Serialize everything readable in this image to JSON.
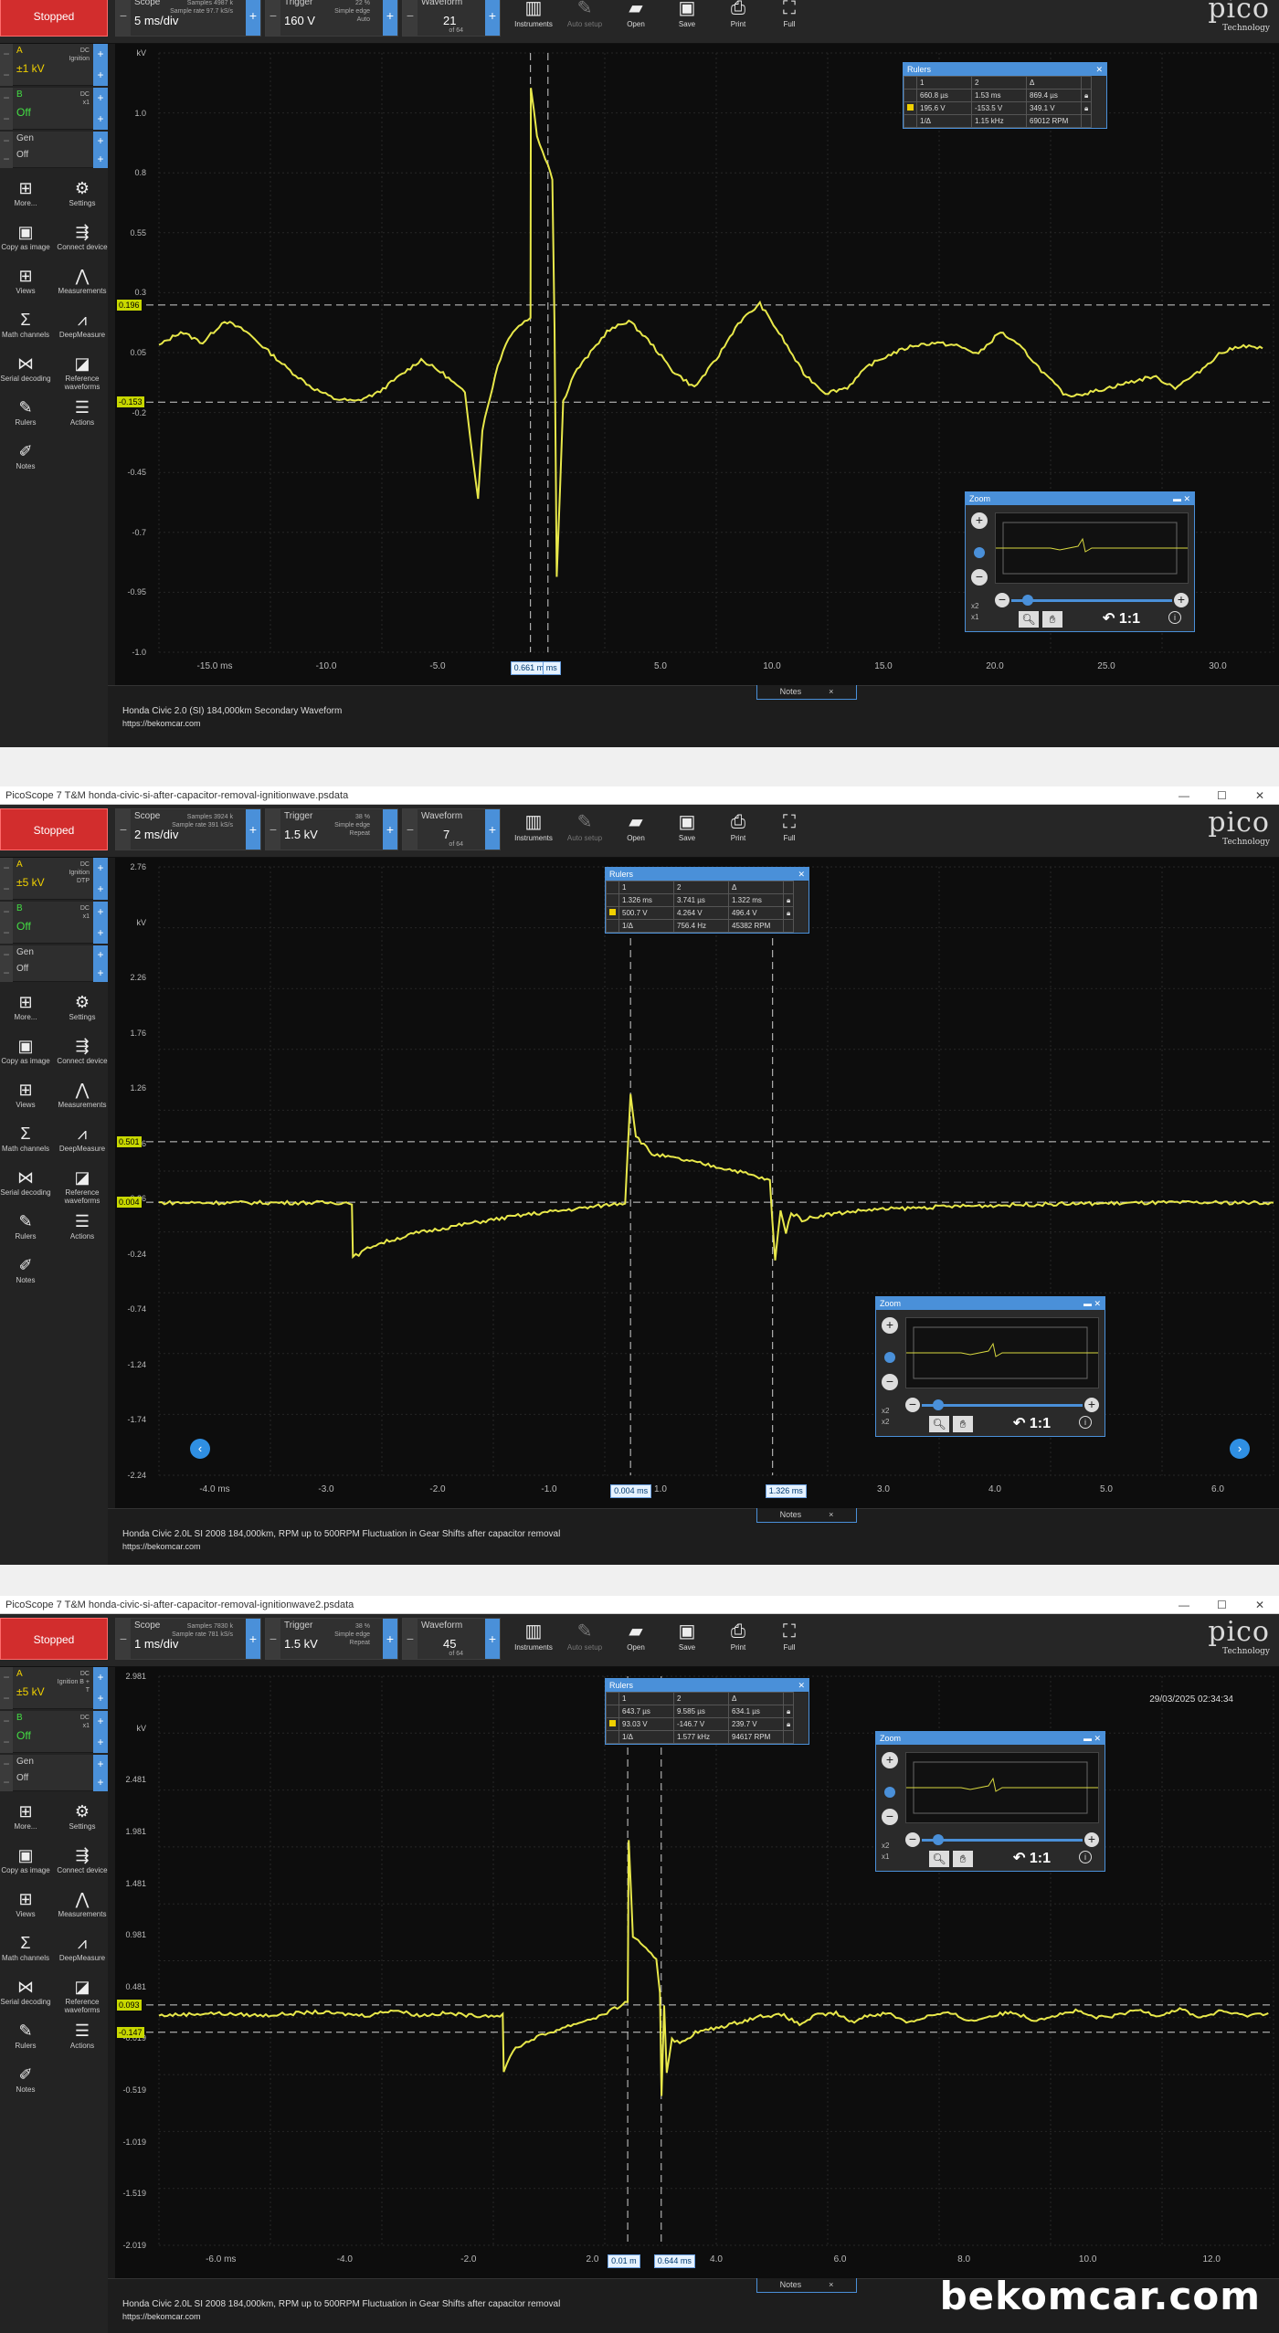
{
  "colors": {
    "trace": "#e8e84a",
    "accent": "#4a90d9",
    "stopped": "#d22d2d",
    "grid": "#2a2a2a",
    "ruler_label": "#c8d800"
  },
  "toolbar_common": {
    "stopped": "Stopped",
    "scope_label": "Scope",
    "trigger_label": "Trigger",
    "waveform_label": "Waveform",
    "instruments": "Instruments",
    "auto_setup": "Auto setup",
    "open": "Open",
    "save": "Save",
    "print": "Print",
    "full": "Full",
    "logo": "pico",
    "logo_sub": "Technology"
  },
  "sidebar_common": {
    "more": "More...",
    "settings": "Settings",
    "copy_image": "Copy as image",
    "connect": "Connect device",
    "views": "Views",
    "measurements": "Measurements",
    "math": "Math channels",
    "deepmeasure": "DeepMeasure",
    "serial": "Serial decoding",
    "reference": "Reference waveforms",
    "rulers": "Rulers",
    "actions": "Actions",
    "notes": "Notes",
    "gen": "Gen",
    "off": "Off",
    "notes_tab": "Notes",
    "notes_close": "×"
  },
  "panels": [
    {
      "window_title": "",
      "toolbar": {
        "scope": "5 ms/div",
        "samples": "Samples 4987 k",
        "sample_rate": "Sample rate 97.7 kS/s",
        "trigger": "160 V",
        "trig_mode": "Simple edge",
        "trig_sub": "Auto",
        "trig_pct": "22 %",
        "waveform": "21",
        "waveform_of": "of 64"
      },
      "channel_a": {
        "name": "A",
        "range": "±1 kV",
        "coupling": "DC",
        "probe": "Ignition"
      },
      "channel_b": {
        "name": "B",
        "state": "Off",
        "coupling": "DC",
        "probe": "x1"
      },
      "y_ticks": [
        "kV",
        "1.0",
        "0.8",
        "0.55",
        "0.3",
        "0.05",
        "-0.2",
        "-0.45",
        "-0.7",
        "-0.95",
        "-1.0"
      ],
      "x_ticks": [
        "-15.0 ms",
        "-10.0",
        "-5.0",
        "0.0",
        "5.0",
        "10.0",
        "15.0",
        "20.0",
        "25.0",
        "30.0"
      ],
      "ruler_labels": [
        "0.196",
        "-0.153"
      ],
      "x_marker": "0.661 ms",
      "x_marker_unit": "ms",
      "rulers": {
        "title": "Rulers",
        "head": [
          "1",
          "2",
          "Δ"
        ],
        "row1": [
          "660.8 µs",
          "1.53 ms",
          "869.4 µs"
        ],
        "row2": [
          "195.6 V",
          "-153.5 V",
          "349.1 V"
        ],
        "row3": [
          "1/Δ",
          "1.15 kHz",
          "69012 RPM"
        ]
      },
      "zoom_title": "Zoom",
      "zoom_1to1": "1:1",
      "zoom_x2": "x2",
      "zoom_x1": "x1",
      "footer_line1": "Honda Civic 2.0 (SI) 184,000km Secondary  Waveform",
      "footer_line2": "https://bekomcar.com",
      "trace": [
        [
          -17,
          0.05
        ],
        [
          -16,
          0.1
        ],
        [
          -15,
          0.06
        ],
        [
          -14,
          0.14
        ],
        [
          -13,
          0.1
        ],
        [
          -12,
          0.03
        ],
        [
          -11,
          -0.04
        ],
        [
          -10,
          -0.1
        ],
        [
          -9,
          -0.14
        ],
        [
          -8,
          -0.15
        ],
        [
          -7,
          -0.12
        ],
        [
          -6,
          -0.06
        ],
        [
          -5,
          0.0
        ],
        [
          -4,
          -0.05
        ],
        [
          -3,
          -0.12
        ],
        [
          -2.4,
          -0.5
        ],
        [
          -2.2,
          -0.25
        ],
        [
          -1.5,
          -0.02
        ],
        [
          -1.0,
          0.08
        ],
        [
          -0.8,
          0.1
        ],
        [
          -0.4,
          0.13
        ],
        [
          0.0,
          0.15
        ],
        [
          0.02,
          0.98
        ],
        [
          0.3,
          0.8
        ],
        [
          0.8,
          0.7
        ],
        [
          1.0,
          0.65
        ],
        [
          1.1,
          0.12
        ],
        [
          1.2,
          -0.78
        ],
        [
          1.5,
          -0.15
        ],
        [
          2.0,
          -0.05
        ],
        [
          2.5,
          0.0
        ],
        [
          3.5,
          0.1
        ],
        [
          4.5,
          0.14
        ],
        [
          5.5,
          0.06
        ],
        [
          6.5,
          -0.04
        ],
        [
          7.5,
          -0.1
        ],
        [
          8.5,
          0.0
        ],
        [
          9.5,
          0.13
        ],
        [
          10.5,
          0.2
        ],
        [
          11.5,
          0.08
        ],
        [
          12.5,
          -0.05
        ],
        [
          13.5,
          -0.12
        ],
        [
          14.5,
          -0.1
        ],
        [
          15.5,
          -0.02
        ],
        [
          16.5,
          0.02
        ],
        [
          17.5,
          0.05
        ],
        [
          18.5,
          0.06
        ],
        [
          19.5,
          0.05
        ],
        [
          20.5,
          0.02
        ],
        [
          21.5,
          0.1
        ],
        [
          22.5,
          0.04
        ],
        [
          23.5,
          -0.05
        ],
        [
          24.5,
          -0.13
        ],
        [
          25.5,
          -0.12
        ],
        [
          26.5,
          -0.1
        ],
        [
          27.5,
          -0.08
        ],
        [
          28.5,
          -0.06
        ],
        [
          29.5,
          -0.1
        ],
        [
          30.5,
          -0.05
        ],
        [
          31.5,
          0.02
        ],
        [
          32.5,
          0.05
        ],
        [
          33.5,
          0.04
        ]
      ],
      "x_range": [
        -17,
        34
      ],
      "y_range": [
        -1.05,
        1.1
      ],
      "rulers_v": [
        0.196,
        -0.153
      ],
      "rulers_t": [
        0.0,
        0.8
      ]
    },
    {
      "window_title": "PicoScope 7 T&M honda-civic-si-after-capacitor-removal-ignitionwave.psdata",
      "toolbar": {
        "scope": "2 ms/div",
        "samples": "Samples 3924 k",
        "sample_rate": "Sample rate 391 kS/s",
        "trigger": "1.5 kV",
        "trig_mode": "Simple edge",
        "trig_sub": "Repeat",
        "trig_pct": "38 %",
        "waveform": "7",
        "waveform_of": "of 64"
      },
      "channel_a": {
        "name": "A",
        "range": "±5 kV",
        "coupling": "DC",
        "probe": "Ignition DTP"
      },
      "channel_b": {
        "name": "B",
        "state": "Off",
        "coupling": "DC",
        "probe": "x1"
      },
      "y_ticks": [
        "2.76",
        "kV",
        "2.26",
        "1.76",
        "1.26",
        "0.76",
        "0.26",
        "-0.24",
        "-0.74",
        "-1.24",
        "-1.74",
        "-2.24"
      ],
      "x_ticks": [
        "-4.0 ms",
        "-3.0",
        "-2.0",
        "-1.0",
        "1.0",
        "2.0",
        "3.0",
        "4.0",
        "5.0",
        "6.0"
      ],
      "ruler_labels": [
        "0.501",
        "0.004"
      ],
      "x_marker": "0.004 ms",
      "x_marker2": "1.326 ms",
      "rulers": {
        "title": "Rulers",
        "head": [
          "1",
          "2",
          "Δ"
        ],
        "row1": [
          "1.326 ms",
          "3.741 µs",
          "1.322 ms"
        ],
        "row2": [
          "500.7 V",
          "4.264 V",
          "496.4 V"
        ],
        "row3": [
          "1/Δ",
          "756.4 Hz",
          "45382 RPM"
        ]
      },
      "zoom_title": "Zoom",
      "zoom_1to1": "1:1",
      "zoom_x2": "x2",
      "zoom_x1": "x2",
      "footer_line1": "Honda Civic 2.0L SI 2008 184,000km, RPM up to 500RPM Fluctuation in  Gear Shifts after capacitor removal",
      "footer_line2": "https://bekomcar.com",
      "trace": [
        [
          -4.4,
          0.0
        ],
        [
          -3.0,
          0.0
        ],
        [
          -2.6,
          0.0
        ],
        [
          -2.59,
          -0.45
        ],
        [
          -2.4,
          -0.35
        ],
        [
          -2.0,
          -0.25
        ],
        [
          -1.5,
          -0.17
        ],
        [
          -1.0,
          -0.1
        ],
        [
          -0.5,
          -0.05
        ],
        [
          -0.05,
          0.0
        ],
        [
          0.0,
          0.9
        ],
        [
          0.05,
          0.55
        ],
        [
          0.2,
          0.4
        ],
        [
          0.5,
          0.35
        ],
        [
          1.0,
          0.26
        ],
        [
          1.3,
          0.18
        ],
        [
          1.32,
          -0.1
        ],
        [
          1.35,
          -0.48
        ],
        [
          1.4,
          -0.05
        ],
        [
          1.45,
          -0.25
        ],
        [
          1.5,
          -0.08
        ],
        [
          1.6,
          -0.14
        ],
        [
          1.8,
          -0.1
        ],
        [
          2.2,
          -0.06
        ],
        [
          3.0,
          -0.03
        ],
        [
          4.0,
          -0.01
        ],
        [
          5.0,
          0.0
        ],
        [
          6.0,
          0.0
        ]
      ],
      "x_range": [
        -4.4,
        6.0
      ],
      "y_range": [
        -2.24,
        2.76
      ],
      "rulers_v": [
        0.501,
        0.004
      ],
      "rulers_t": [
        0.0,
        1.326
      ]
    },
    {
      "window_title": "PicoScope 7 T&M honda-civic-si-after-capacitor-removal-ignitionwave2.psdata",
      "toolbar": {
        "scope": "1 ms/div",
        "samples": "Samples 7830 k",
        "sample_rate": "Sample rate 781 kS/s",
        "trigger": "1.5 kV",
        "trig_mode": "Simple edge",
        "trig_sub": "Repeat",
        "trig_pct": "38 %",
        "waveform": "45",
        "waveform_of": "of 64"
      },
      "channel_a": {
        "name": "A",
        "range": "±5 kV",
        "coupling": "DC",
        "probe": "Ignition B + T"
      },
      "channel_b": {
        "name": "B",
        "state": "Off",
        "coupling": "DC",
        "probe": "x1"
      },
      "y_ticks": [
        "2.981",
        "kV",
        "2.481",
        "1.981",
        "1.481",
        "0.981",
        "0.481",
        "-0.019",
        "-0.519",
        "-1.019",
        "-1.519",
        "-2.019"
      ],
      "x_ticks": [
        "-6.0 ms",
        "-4.0",
        "-2.0",
        "2.0",
        "4.0",
        "6.0",
        "8.0",
        "10.0",
        "12.0"
      ],
      "ruler_labels": [
        "0.093",
        "-0.147"
      ],
      "x_marker": "0.01 m",
      "x_marker2": "0.644 ms",
      "timestamp": "29/03/2025 02:34:34",
      "rulers": {
        "title": "Rulers",
        "head": [
          "1",
          "2",
          "Δ"
        ],
        "row1": [
          "643.7 µs",
          "9.585 µs",
          "634.1 µs"
        ],
        "row2": [
          "93.03 V",
          "-146.7 V",
          "239.7 V"
        ],
        "row3": [
          "1/Δ",
          "1.577 kHz",
          "94617 RPM"
        ]
      },
      "zoom_title": "Zoom",
      "zoom_1to1": "1:1",
      "zoom_x2": "x2",
      "zoom_x1": "x1",
      "footer_line1": "Honda Civic 2.0L SI 2008 184,000km, RPM up to 500RPM Fluctuation in  Gear Shifts after capacitor removal",
      "footer_line2": "https://bekomcar.com",
      "trace": [
        [
          -9.0,
          0.0
        ],
        [
          -8.0,
          0.02
        ],
        [
          -7.0,
          0.0
        ],
        [
          -6.0,
          0.03
        ],
        [
          -5.0,
          0.0
        ],
        [
          -4.5,
          0.05
        ],
        [
          -4.0,
          0.0
        ],
        [
          -3.5,
          0.02
        ],
        [
          -3.0,
          0.0
        ],
        [
          -2.4,
          0.0
        ],
        [
          -2.38,
          -0.5
        ],
        [
          -2.2,
          -0.3
        ],
        [
          -1.8,
          -0.2
        ],
        [
          -1.2,
          -0.1
        ],
        [
          -0.5,
          0.0
        ],
        [
          0.0,
          0.12
        ],
        [
          0.02,
          1.55
        ],
        [
          0.1,
          0.7
        ],
        [
          0.3,
          0.6
        ],
        [
          0.55,
          0.5
        ],
        [
          0.62,
          0.2
        ],
        [
          0.65,
          -0.7
        ],
        [
          0.7,
          0.1
        ],
        [
          0.75,
          -0.5
        ],
        [
          0.85,
          -0.2
        ],
        [
          1.0,
          -0.25
        ],
        [
          1.3,
          -0.15
        ],
        [
          1.8,
          -0.1
        ],
        [
          2.2,
          -0.05
        ],
        [
          2.6,
          0.0
        ],
        [
          3.0,
          0.0
        ],
        [
          3.3,
          -0.08
        ],
        [
          3.6,
          0.0
        ],
        [
          4.0,
          0.02
        ],
        [
          4.3,
          -0.06
        ],
        [
          4.6,
          0.0
        ],
        [
          5.0,
          0.02
        ],
        [
          5.4,
          -0.06
        ],
        [
          5.8,
          0.0
        ],
        [
          6.2,
          0.02
        ],
        [
          6.6,
          -0.05
        ],
        [
          7.0,
          0.0
        ],
        [
          7.4,
          0.03
        ],
        [
          7.8,
          -0.04
        ],
        [
          8.2,
          0.0
        ],
        [
          8.6,
          0.04
        ],
        [
          9.0,
          -0.02
        ],
        [
          9.4,
          0.0
        ],
        [
          9.8,
          0.05
        ],
        [
          10.2,
          0.0
        ],
        [
          10.6,
          0.06
        ],
        [
          11.0,
          -0.02
        ],
        [
          11.4,
          0.04
        ],
        [
          11.8,
          0.0
        ],
        [
          12.3,
          0.02
        ]
      ],
      "x_range": [
        -9.0,
        12.4
      ],
      "y_range": [
        -2.019,
        2.981
      ],
      "rulers_v": [
        0.093,
        -0.147
      ],
      "rulers_t": [
        0.0,
        0.644
      ]
    }
  ],
  "watermark": "bekomcar.com"
}
